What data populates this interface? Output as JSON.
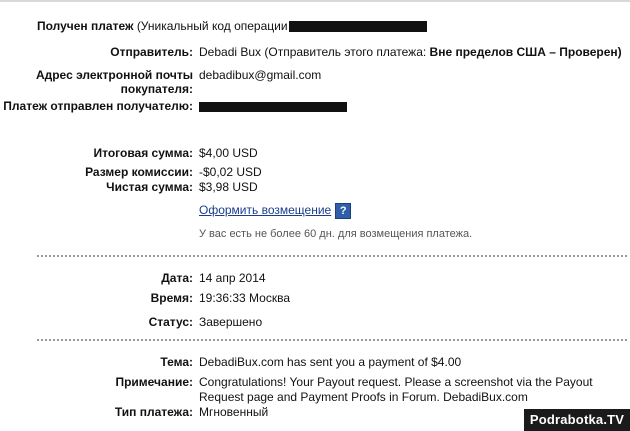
{
  "header": {
    "received_label": "Получен платеж",
    "txn_prefix": "(Уникальный код операции"
  },
  "sender": {
    "label": "Отправитель:",
    "value_prefix": "Debadi Bux (Отправитель этого платежа: ",
    "value_bold": "Вне пределов США – Проверен)"
  },
  "buyer_email": {
    "label": "Адрес электронной почты покупателя:",
    "value": "debadibux@gmail.com"
  },
  "sent_to": {
    "label": "Платеж отправлен получателю:"
  },
  "totals": {
    "total_label": "Итоговая сумма:",
    "total_value": "$4,00 USD",
    "fee_label": "Размер комиссии:",
    "fee_value": "-$0,02 USD",
    "net_label": "Чистая сумма:",
    "net_value": "$3,98 USD"
  },
  "refund": {
    "link_label": "Оформить возмещение",
    "help_icon": "?",
    "note": "У вас есть не более 60 дн. для возмещения платежа."
  },
  "details": {
    "date_label": "Дата:",
    "date_value": "14 апр 2014",
    "time_label": "Время:",
    "time_value": "19:36:33 Москва",
    "status_label": "Статус:",
    "status_value": "Завершено"
  },
  "message": {
    "subject_label": "Тема:",
    "subject_value": "DebadiBux.com has sent you a payment of $4.00",
    "note_label": "Примечание:",
    "note_line1": "Congratulations! Your Payout request. Please a screenshot via the Payout",
    "note_line2": "Request page and Payment Proofs in Forum. DebadiBux.com",
    "type_label": "Тип платежа:",
    "type_value": "Мгновенный"
  },
  "watermark": "Podrabotka.TV",
  "icons": {
    "help": "help-question-icon"
  },
  "colors": {
    "link": "#1a3c8c",
    "help_icon": "#2f5fa8",
    "watermark_bg": "#1b1b1b"
  }
}
